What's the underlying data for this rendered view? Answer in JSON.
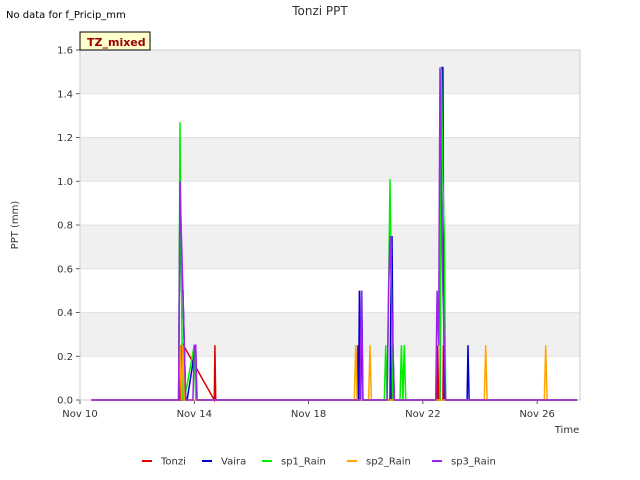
{
  "header": {
    "no_data_note": "No data for f_Pricip_mm",
    "tz_label": "TZ_mixed"
  },
  "chart_data": {
    "type": "line",
    "title": "Tonzi PPT",
    "xlabel": "Time",
    "ylabel": "PPT (mm)",
    "x_unit": "day of November",
    "xlim": [
      10,
      27.5
    ],
    "ylim": [
      0,
      1.6
    ],
    "x_ticks": [
      10,
      14,
      18,
      22,
      26
    ],
    "x_tick_labels": [
      "Nov 10",
      "Nov 14",
      "Nov 18",
      "Nov 22",
      "Nov 26"
    ],
    "y_ticks": [
      0.0,
      0.2,
      0.4,
      0.6,
      0.8,
      1.0,
      1.2,
      1.4,
      1.6
    ],
    "y_tick_labels": [
      "0.0",
      "0.2",
      "0.4",
      "0.6",
      "0.8",
      "1.0",
      "1.2",
      "1.4",
      "1.6"
    ],
    "grid": true,
    "legend_position": "bottom",
    "series": [
      {
        "name": "Tonzi",
        "color": "#dd0000",
        "x": [
          10.4,
          13.5,
          13.52,
          13.55,
          13.6,
          13.62,
          14.7,
          14.72,
          14.75,
          19.7,
          19.72,
          19.75,
          20.9,
          20.92,
          20.95,
          22.5,
          22.52,
          22.55,
          22.7,
          22.72,
          22.75,
          27.4
        ],
        "y": [
          0,
          0,
          0.25,
          0,
          0,
          0.25,
          0,
          0.25,
          0,
          0,
          0.25,
          0,
          0,
          0.25,
          0,
          0,
          0.25,
          0,
          0,
          0.25,
          0,
          0
        ]
      },
      {
        "name": "Vaira",
        "color": "#0000cc",
        "x": [
          10.4,
          13.45,
          13.5,
          13.55,
          13.6,
          13.65,
          13.7,
          13.75,
          14.05,
          14.08,
          14.12,
          19.75,
          19.78,
          19.82,
          19.86,
          19.9,
          20.85,
          20.88,
          20.92,
          20.95,
          21.0,
          22.6,
          22.63,
          22.66,
          22.7,
          22.74,
          22.78,
          23.55,
          23.58,
          23.62,
          27.4
        ],
        "y": [
          0,
          0,
          1.0,
          0.5,
          0.5,
          0.25,
          0,
          0,
          0.25,
          0,
          0,
          0,
          0.5,
          0,
          0.5,
          0,
          0,
          0.5,
          0.75,
          0.25,
          0,
          0,
          1.0,
          1.52,
          1.52,
          0.25,
          0,
          0,
          0.25,
          0,
          0
        ]
      },
      {
        "name": "sp1_Rain",
        "color": "#00ee00",
        "x": [
          10.4,
          13.45,
          13.5,
          13.55,
          13.6,
          13.65,
          14.0,
          14.05,
          14.1,
          20.65,
          20.7,
          20.75,
          20.8,
          20.85,
          20.9,
          20.95,
          21.2,
          21.25,
          21.3,
          21.35,
          21.4,
          22.6,
          22.65,
          22.7,
          22.75,
          22.8,
          27.4
        ],
        "y": [
          0,
          0,
          1.27,
          0.5,
          0,
          0,
          0.25,
          0,
          0,
          0,
          0.25,
          0,
          0.5,
          1.01,
          0.5,
          0,
          0,
          0.25,
          0,
          0.25,
          0,
          0,
          1.52,
          1.0,
          0.75,
          0,
          0
        ]
      },
      {
        "name": "sp2_Rain",
        "color": "#ffa500",
        "x": [
          10.4,
          13.45,
          13.5,
          13.55,
          13.6,
          13.65,
          19.6,
          19.65,
          19.7,
          20.1,
          20.15,
          20.2,
          24.15,
          24.2,
          24.25,
          26.25,
          26.3,
          26.35,
          27.4
        ],
        "y": [
          0,
          0,
          0.25,
          0,
          0.25,
          0,
          0,
          0.25,
          0,
          0,
          0.25,
          0,
          0,
          0.25,
          0,
          0,
          0.25,
          0,
          0
        ]
      },
      {
        "name": "sp3_Rain",
        "color": "#a020f0",
        "x": [
          10.4,
          13.45,
          13.5,
          13.55,
          13.6,
          13.65,
          13.7,
          13.75,
          13.95,
          14.0,
          14.05,
          14.1,
          19.8,
          19.85,
          19.9,
          20.75,
          20.8,
          20.85,
          20.9,
          20.95,
          21.0,
          22.45,
          22.5,
          22.55,
          22.6,
          22.65,
          22.7,
          22.75,
          22.8,
          27.4
        ],
        "y": [
          0,
          0,
          1.0,
          0.75,
          0.5,
          0.25,
          0,
          0,
          0,
          0.25,
          0.25,
          0,
          0,
          0.5,
          0,
          0,
          0.5,
          0.75,
          0.5,
          0.25,
          0,
          0,
          0.5,
          0.25,
          1.52,
          1.0,
          0.5,
          0.25,
          0,
          0
        ]
      }
    ]
  }
}
